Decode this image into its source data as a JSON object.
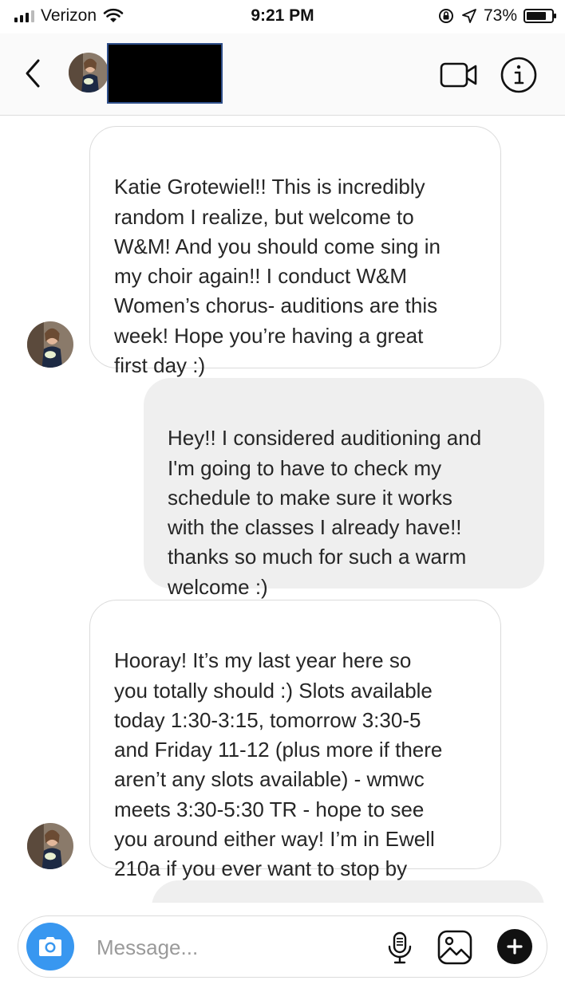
{
  "status_bar": {
    "carrier": "Verizon",
    "time": "9:21 PM",
    "battery": "73%",
    "battery_level": 0.73
  },
  "header": {
    "contact_name": "",
    "icons": [
      "back-chevron-icon",
      "video-camera-icon",
      "info-icon"
    ]
  },
  "messages": [
    {
      "direction": "incoming",
      "text": "Katie Grotewiel!! This is incredibly\nrandom I realize, but welcome to\nW&M! And you should come sing in\nmy choir again!! I conduct W&M\nWomen’s chorus- auditions are this\nweek! Hope you’re having a great\nfirst day :)"
    },
    {
      "direction": "outgoing",
      "text": "Hey!! I considered auditioning and\nI'm going to have to check my\nschedule to make sure it works\nwith the classes I already have!!\nthanks so much for such a warm\nwelcome :)"
    },
    {
      "direction": "incoming",
      "text": "Hooray! It’s my last year here so\nyou totally should :) Slots available\ntoday 1:30-3:15, tomorrow 3:30-5\nand Friday 11-12 (plus more if there\naren’t any slots available) - wmwc\nmeets 3:30-5:30 TR - hope to see\nyou around either way! I’m in Ewell\n210a if you ever want to stop by"
    },
    {
      "direction": "outgoing",
      "text": ""
    }
  ],
  "composer": {
    "placeholder": "Message...",
    "value": ""
  },
  "colors": {
    "accent": "#3897f0",
    "incoming_bubble_border": "#dbdbdb",
    "outgoing_bubble_bg": "#efefef",
    "redaction": "#000000"
  }
}
